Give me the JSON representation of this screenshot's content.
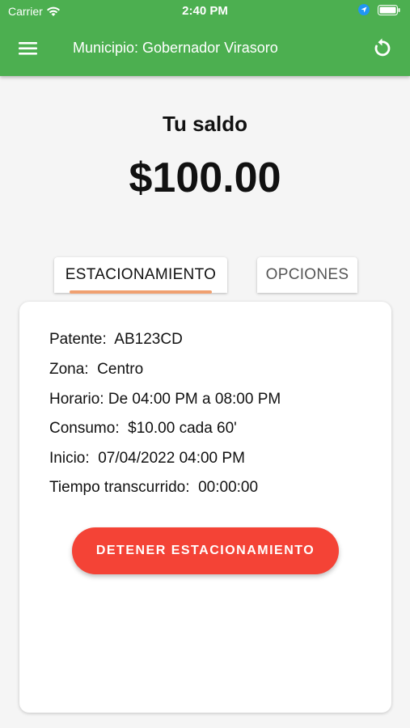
{
  "status_bar": {
    "carrier": "Carrier",
    "time": "2:40 PM"
  },
  "app_bar": {
    "title": "Municipio: Gobernador Virasoro",
    "menu_icon": "hamburger-menu-icon",
    "refresh_icon": "refresh-icon"
  },
  "balance": {
    "label": "Tu saldo",
    "amount": "$100.00"
  },
  "tabs": [
    {
      "label": "ESTACIONAMIENTO",
      "active": true
    },
    {
      "label": "OPCIONES",
      "active": false
    }
  ],
  "parking": {
    "patente_label": "Patente:",
    "patente": "AB123CD",
    "zona_label": "Zona:",
    "zona": "Centro",
    "horario_label": "Horario:",
    "horario": "De 04:00 PM a 08:00 PM",
    "consumo_label": "Consumo:",
    "consumo": "$10.00 cada 60'",
    "inicio_label": "Inicio:",
    "inicio": "07/04/2022 04:00 PM",
    "tiempo_label": "Tiempo transcurrido:",
    "tiempo": "00:00:00"
  },
  "stop_button_label": "DETENER ESTACIONAMIENTO",
  "colors": {
    "primary": "#4caf50",
    "danger": "#f44336",
    "tab_indicator": "#f0a070"
  }
}
